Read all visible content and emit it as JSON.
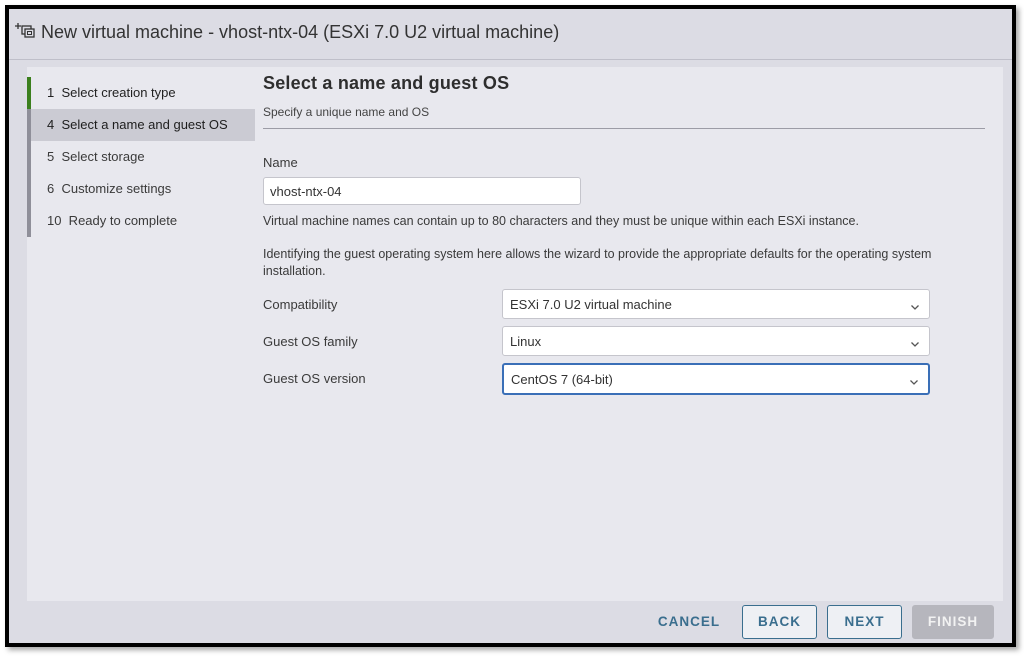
{
  "window": {
    "title": "New virtual machine - vhost-ntx-04 (ESXi 7.0 U2 virtual machine)",
    "icon": "new-vm-icon"
  },
  "steps": [
    {
      "label": "1  Select creation type",
      "state": "done"
    },
    {
      "label": "4  Select a name and guest OS",
      "state": "active"
    },
    {
      "label": "5  Select storage",
      "state": "pending"
    },
    {
      "label": "6  Customize settings",
      "state": "pending"
    },
    {
      "label": "10  Ready to complete",
      "state": "pending"
    }
  ],
  "page": {
    "title": "Select a name and guest OS",
    "subtitle": "Specify a unique name and OS"
  },
  "form": {
    "name_label": "Name",
    "name_value": "vhost-ntx-04",
    "name_note": "Virtual machine names can contain up to 80 characters and they must be unique within each ESXi instance.",
    "os_note": "Identifying the guest operating system here allows the wizard to provide the appropriate defaults for the operating system installation.",
    "compatibility_label": "Compatibility",
    "compatibility_value": "ESXi 7.0 U2 virtual machine",
    "os_family_label": "Guest OS family",
    "os_family_value": "Linux",
    "os_version_label": "Guest OS version",
    "os_version_value": "CentOS 7 (64-bit)"
  },
  "footer": {
    "cancel": "CANCEL",
    "back": "BACK",
    "next": "NEXT",
    "finish": "FINISH"
  },
  "colors": {
    "accent": "#3a6e8e",
    "focus": "#3a6fb7",
    "done_step": "#3b7f1d"
  }
}
